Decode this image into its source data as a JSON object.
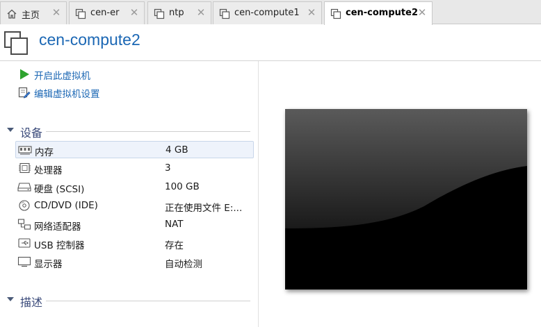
{
  "tabs": [
    {
      "label": "主页",
      "icon": "home-icon",
      "active": false
    },
    {
      "label": "cen-er",
      "icon": "vm-icon",
      "active": false
    },
    {
      "label": "ntp",
      "icon": "vm-icon",
      "active": false
    },
    {
      "label": "cen-compute1",
      "icon": "vm-icon",
      "active": false
    },
    {
      "label": "cen-compute2",
      "icon": "vm-icon",
      "active": true
    }
  ],
  "tab_close_glyph": "✕",
  "vm": {
    "title": "cen-compute2"
  },
  "actions": [
    {
      "label": "开启此虚拟机",
      "icon": "power-on-icon",
      "color": "#2ea32e"
    },
    {
      "label": "编辑虚拟机设置",
      "icon": "edit-settings-icon"
    }
  ],
  "sections": {
    "devices": "设备",
    "description": "描述"
  },
  "devices": [
    {
      "name": "内存",
      "value": "4 GB",
      "icon": "memory-icon",
      "selected": true
    },
    {
      "name": "处理器",
      "value": "3",
      "icon": "cpu-icon"
    },
    {
      "name": "硬盘 (SCSI)",
      "value": "100 GB",
      "icon": "hard-disk-icon"
    },
    {
      "name": "CD/DVD (IDE)",
      "value": "正在使用文件 E:...",
      "icon": "cd-dvd-icon"
    },
    {
      "name": "网络适配器",
      "value": "NAT",
      "icon": "network-adapter-icon"
    },
    {
      "name": "USB 控制器",
      "value": "存在",
      "icon": "usb-icon"
    },
    {
      "name": "显示器",
      "value": "自动检测",
      "icon": "display-icon"
    }
  ],
  "colors": {
    "link": "#1b67b4",
    "section": "#3a4a7a",
    "play": "#2ea32e"
  }
}
